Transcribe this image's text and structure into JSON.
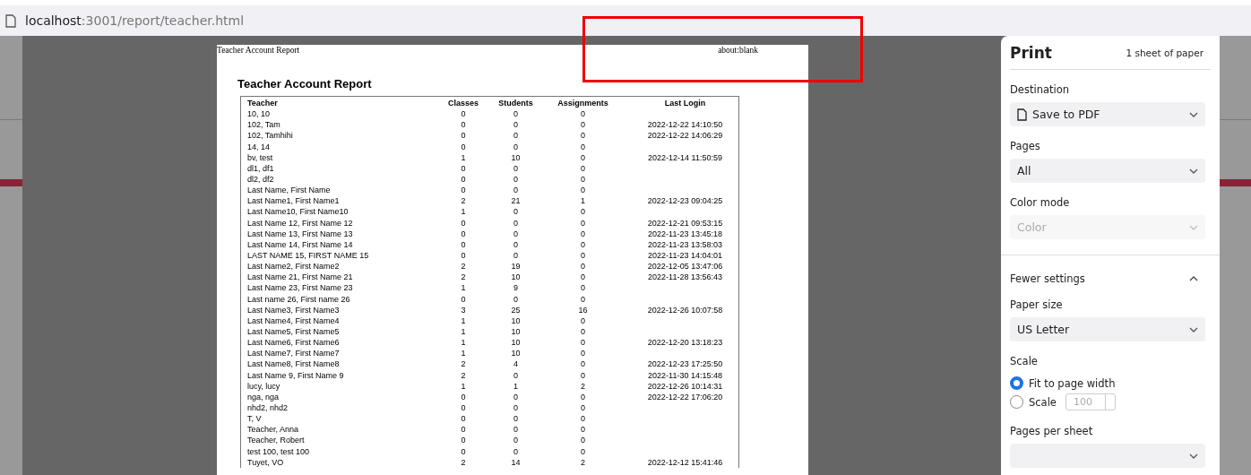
{
  "address_bar": {
    "host": "localhost",
    "path": ":3001/report/teacher.html"
  },
  "preview": {
    "header_left": "Teacher Account Report",
    "header_right": "about:blank",
    "title": "Teacher Account Report",
    "table": {
      "columns": [
        "Teacher",
        "Classes",
        "Students",
        "Assignments",
        "Last Login"
      ],
      "rows": [
        [
          "10, 10",
          "0",
          "0",
          "0",
          ""
        ],
        [
          "102, Tam",
          "0",
          "0",
          "0",
          "2022-12-22 14:10:50"
        ],
        [
          "102, Tamhihi",
          "0",
          "0",
          "0",
          "2022-12-22 14:06:29"
        ],
        [
          "14, 14",
          "0",
          "0",
          "0",
          ""
        ],
        [
          "bv, test",
          "1",
          "10",
          "0",
          "2022-12-14 11:50:59"
        ],
        [
          "dl1, df1",
          "0",
          "0",
          "0",
          ""
        ],
        [
          "dl2, df2",
          "0",
          "0",
          "0",
          ""
        ],
        [
          "Last Name, First Name",
          "0",
          "0",
          "0",
          ""
        ],
        [
          "Last Name1, First Name1",
          "2",
          "21",
          "1",
          "2022-12-23 09:04:25"
        ],
        [
          "Last Name10, First Name10",
          "1",
          "0",
          "0",
          ""
        ],
        [
          "Last Name 12, First Name 12",
          "0",
          "0",
          "0",
          "2022-12-21 09:53:15"
        ],
        [
          "Last Name 13, First Name 13",
          "0",
          "0",
          "0",
          "2022-11-23 13:45:18"
        ],
        [
          "Last Name 14, First Name 14",
          "0",
          "0",
          "0",
          "2022-11-23 13:58:03"
        ],
        [
          "LAST NAME 15, FIRST NAME 15",
          "0",
          "0",
          "0",
          "2022-11-23 14:04:01"
        ],
        [
          "Last Name2, First Name2",
          "2",
          "19",
          "0",
          "2022-12-05 13:47:06"
        ],
        [
          "Last Name 21, First Name 21",
          "2",
          "10",
          "0",
          "2022-11-28 13:56:43"
        ],
        [
          "Last Name 23, First Name 23",
          "1",
          "9",
          "0",
          ""
        ],
        [
          "Last name 26, First name 26",
          "0",
          "0",
          "0",
          ""
        ],
        [
          "Last Name3, First Name3",
          "3",
          "25",
          "16",
          "2022-12-26 10:07:58"
        ],
        [
          "Last Name4, First Name4",
          "1",
          "10",
          "0",
          ""
        ],
        [
          "Last Name5, First Name5",
          "1",
          "10",
          "0",
          ""
        ],
        [
          "Last Name6, First Name6",
          "1",
          "10",
          "0",
          "2022-12-20 13:18:23"
        ],
        [
          "Last Name7, First Name7",
          "1",
          "10",
          "0",
          ""
        ],
        [
          "Last Name8, First Name8",
          "2",
          "4",
          "0",
          "2022-12-23 17:25:50"
        ],
        [
          "Last Name 9, First Name 9",
          "2",
          "0",
          "0",
          "2022-11-30 14:15:48"
        ],
        [
          "lucy, lucy",
          "1",
          "1",
          "2",
          "2022-12-26 10:14:31"
        ],
        [
          "nga, nga",
          "0",
          "0",
          "0",
          "2022-12-22 17:06:20"
        ],
        [
          "nhd2, nhd2",
          "0",
          "0",
          "0",
          ""
        ],
        [
          "T, V",
          "0",
          "0",
          "0",
          ""
        ],
        [
          "Teacher, Anna",
          "0",
          "0",
          "0",
          ""
        ],
        [
          "Teacher, Robert",
          "0",
          "0",
          "0",
          ""
        ],
        [
          "test 100, test 100",
          "0",
          "0",
          "0",
          ""
        ],
        [
          "Tuyet, VO",
          "2",
          "14",
          "2",
          "2022-12-12 15:41:46"
        ]
      ]
    }
  },
  "print_panel": {
    "title": "Print",
    "sheet_count": "1 sheet of paper",
    "settings": [
      {
        "kind": "select",
        "label": "Destination",
        "value": "Save to PDF",
        "file_icon": true,
        "disabled": false
      },
      {
        "kind": "select",
        "label": "Pages",
        "value": "All",
        "file_icon": false,
        "disabled": false
      },
      {
        "kind": "select",
        "label": "Color mode",
        "value": "Color",
        "file_icon": false,
        "disabled": true
      },
      {
        "kind": "toggle",
        "label": "Fewer settings",
        "expanded": true
      },
      {
        "kind": "select",
        "label": "Paper size",
        "value": "US Letter",
        "file_icon": false,
        "disabled": false
      },
      {
        "kind": "radio",
        "label": "Scale",
        "options": [
          {
            "label": "Fit to page width",
            "selected": true
          },
          {
            "label": "Scale",
            "selected": false,
            "input_value": "100",
            "input_disabled": true
          }
        ]
      },
      {
        "kind": "select",
        "label": "Pages per sheet",
        "file_icon": false,
        "disabled": false
      }
    ]
  }
}
